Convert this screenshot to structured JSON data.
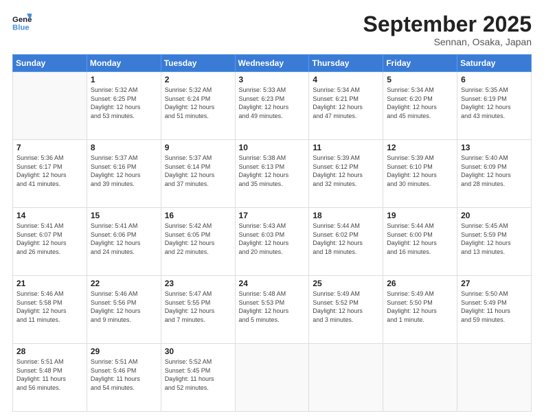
{
  "header": {
    "logo_line1": "General",
    "logo_line2": "Blue",
    "month": "September 2025",
    "location": "Sennan, Osaka, Japan"
  },
  "weekdays": [
    "Sunday",
    "Monday",
    "Tuesday",
    "Wednesday",
    "Thursday",
    "Friday",
    "Saturday"
  ],
  "weeks": [
    [
      {
        "day": "",
        "info": ""
      },
      {
        "day": "1",
        "info": "Sunrise: 5:32 AM\nSunset: 6:25 PM\nDaylight: 12 hours\nand 53 minutes."
      },
      {
        "day": "2",
        "info": "Sunrise: 5:32 AM\nSunset: 6:24 PM\nDaylight: 12 hours\nand 51 minutes."
      },
      {
        "day": "3",
        "info": "Sunrise: 5:33 AM\nSunset: 6:23 PM\nDaylight: 12 hours\nand 49 minutes."
      },
      {
        "day": "4",
        "info": "Sunrise: 5:34 AM\nSunset: 6:21 PM\nDaylight: 12 hours\nand 47 minutes."
      },
      {
        "day": "5",
        "info": "Sunrise: 5:34 AM\nSunset: 6:20 PM\nDaylight: 12 hours\nand 45 minutes."
      },
      {
        "day": "6",
        "info": "Sunrise: 5:35 AM\nSunset: 6:19 PM\nDaylight: 12 hours\nand 43 minutes."
      }
    ],
    [
      {
        "day": "7",
        "info": "Sunrise: 5:36 AM\nSunset: 6:17 PM\nDaylight: 12 hours\nand 41 minutes."
      },
      {
        "day": "8",
        "info": "Sunrise: 5:37 AM\nSunset: 6:16 PM\nDaylight: 12 hours\nand 39 minutes."
      },
      {
        "day": "9",
        "info": "Sunrise: 5:37 AM\nSunset: 6:14 PM\nDaylight: 12 hours\nand 37 minutes."
      },
      {
        "day": "10",
        "info": "Sunrise: 5:38 AM\nSunset: 6:13 PM\nDaylight: 12 hours\nand 35 minutes."
      },
      {
        "day": "11",
        "info": "Sunrise: 5:39 AM\nSunset: 6:12 PM\nDaylight: 12 hours\nand 32 minutes."
      },
      {
        "day": "12",
        "info": "Sunrise: 5:39 AM\nSunset: 6:10 PM\nDaylight: 12 hours\nand 30 minutes."
      },
      {
        "day": "13",
        "info": "Sunrise: 5:40 AM\nSunset: 6:09 PM\nDaylight: 12 hours\nand 28 minutes."
      }
    ],
    [
      {
        "day": "14",
        "info": "Sunrise: 5:41 AM\nSunset: 6:07 PM\nDaylight: 12 hours\nand 26 minutes."
      },
      {
        "day": "15",
        "info": "Sunrise: 5:41 AM\nSunset: 6:06 PM\nDaylight: 12 hours\nand 24 minutes."
      },
      {
        "day": "16",
        "info": "Sunrise: 5:42 AM\nSunset: 6:05 PM\nDaylight: 12 hours\nand 22 minutes."
      },
      {
        "day": "17",
        "info": "Sunrise: 5:43 AM\nSunset: 6:03 PM\nDaylight: 12 hours\nand 20 minutes."
      },
      {
        "day": "18",
        "info": "Sunrise: 5:44 AM\nSunset: 6:02 PM\nDaylight: 12 hours\nand 18 minutes."
      },
      {
        "day": "19",
        "info": "Sunrise: 5:44 AM\nSunset: 6:00 PM\nDaylight: 12 hours\nand 16 minutes."
      },
      {
        "day": "20",
        "info": "Sunrise: 5:45 AM\nSunset: 5:59 PM\nDaylight: 12 hours\nand 13 minutes."
      }
    ],
    [
      {
        "day": "21",
        "info": "Sunrise: 5:46 AM\nSunset: 5:58 PM\nDaylight: 12 hours\nand 11 minutes."
      },
      {
        "day": "22",
        "info": "Sunrise: 5:46 AM\nSunset: 5:56 PM\nDaylight: 12 hours\nand 9 minutes."
      },
      {
        "day": "23",
        "info": "Sunrise: 5:47 AM\nSunset: 5:55 PM\nDaylight: 12 hours\nand 7 minutes."
      },
      {
        "day": "24",
        "info": "Sunrise: 5:48 AM\nSunset: 5:53 PM\nDaylight: 12 hours\nand 5 minutes."
      },
      {
        "day": "25",
        "info": "Sunrise: 5:49 AM\nSunset: 5:52 PM\nDaylight: 12 hours\nand 3 minutes."
      },
      {
        "day": "26",
        "info": "Sunrise: 5:49 AM\nSunset: 5:50 PM\nDaylight: 12 hours\nand 1 minute."
      },
      {
        "day": "27",
        "info": "Sunrise: 5:50 AM\nSunset: 5:49 PM\nDaylight: 11 hours\nand 59 minutes."
      }
    ],
    [
      {
        "day": "28",
        "info": "Sunrise: 5:51 AM\nSunset: 5:48 PM\nDaylight: 11 hours\nand 56 minutes."
      },
      {
        "day": "29",
        "info": "Sunrise: 5:51 AM\nSunset: 5:46 PM\nDaylight: 11 hours\nand 54 minutes."
      },
      {
        "day": "30",
        "info": "Sunrise: 5:52 AM\nSunset: 5:45 PM\nDaylight: 11 hours\nand 52 minutes."
      },
      {
        "day": "",
        "info": ""
      },
      {
        "day": "",
        "info": ""
      },
      {
        "day": "",
        "info": ""
      },
      {
        "day": "",
        "info": ""
      }
    ]
  ]
}
